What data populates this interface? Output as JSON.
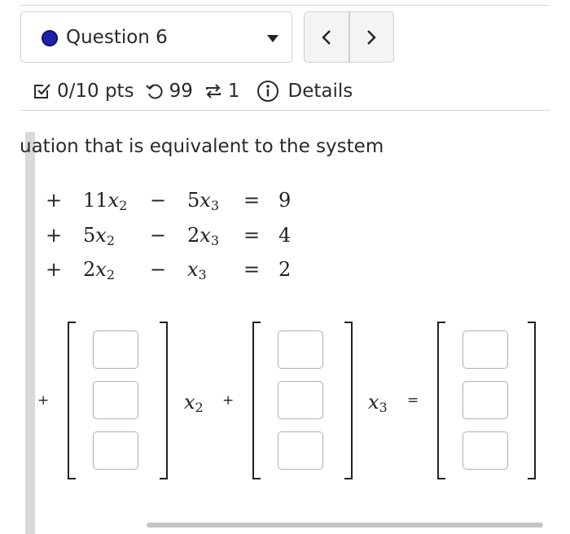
{
  "question": {
    "status_color": "#1e22a8",
    "label": "Question 6",
    "dropdown_icon": "caret-down-icon"
  },
  "nav": {
    "prev_icon": "chevron-left-icon",
    "next_icon": "chevron-right-icon"
  },
  "meta": {
    "points": "0/10 pts",
    "attempts": "99",
    "versions": "1",
    "details": "Details"
  },
  "prompt_text": "uation that is equivalent to the system",
  "system": [
    {
      "op1": "+",
      "c2": "11",
      "var2": "x",
      "sub2": "2",
      "op2": "−",
      "c3": "5",
      "var3": "x",
      "sub3": "3",
      "eq": "=",
      "rhs": "9"
    },
    {
      "op1": "+",
      "c2": "5",
      "var2": "x",
      "sub2": "2",
      "op2": "−",
      "c3": "2",
      "var3": "x",
      "sub3": "3",
      "eq": "=",
      "rhs": "4"
    },
    {
      "op1": "+",
      "c2": "2",
      "var2": "x",
      "sub2": "2",
      "op2": "−",
      "c3": "",
      "var3": "x",
      "sub3": "3",
      "eq": "=",
      "rhs": "2"
    }
  ],
  "vector_equation": {
    "plus_1": "+",
    "var_a": "x",
    "sub_a": "2",
    "plus_2": "+",
    "var_b": "x",
    "sub_b": "3",
    "equals": "=",
    "vec_x2": [
      "",
      "",
      ""
    ],
    "vec_x3": [
      "",
      "",
      ""
    ],
    "vec_rhs": [
      "",
      "",
      ""
    ]
  }
}
